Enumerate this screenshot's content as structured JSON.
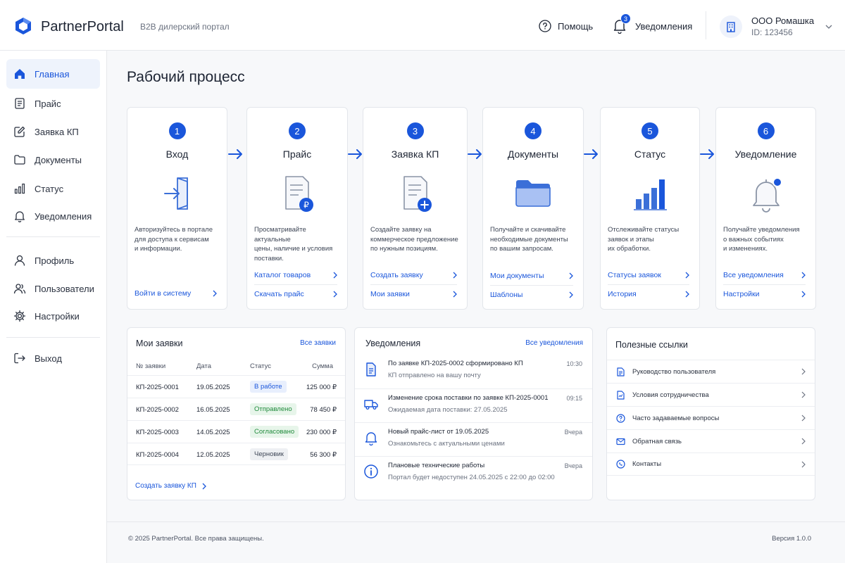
{
  "header": {
    "brand": "PartnerPortal",
    "tagline": "B2B дилерский портал",
    "help_label": "Помощь",
    "notifications_label": "Уведомления",
    "notifications_count": "3",
    "company_name": "ООО Ромашка",
    "company_id": "ID: 123456"
  },
  "sidebar": {
    "items": [
      {
        "label": "Главная",
        "icon": "home-icon",
        "active": true
      },
      {
        "label": "Прайс",
        "icon": "document-icon"
      },
      {
        "label": "Заявка КП",
        "icon": "edit-icon"
      },
      {
        "label": "Документы",
        "icon": "folder-icon"
      },
      {
        "label": "Статус",
        "icon": "chart-icon"
      },
      {
        "label": "Уведомления",
        "icon": "bell-icon"
      },
      {
        "label": "Профиль",
        "icon": "user-icon"
      },
      {
        "label": "Пользователи",
        "icon": "users-icon"
      },
      {
        "label": "Настройки",
        "icon": "gear-icon"
      },
      {
        "label": "Выход",
        "icon": "logout-icon"
      }
    ]
  },
  "main": {
    "title": "Рабочий процесс",
    "steps": [
      {
        "num": "1",
        "title": "Вход",
        "desc": [
          "Авторизуйтесь в портале",
          "для доступа к сервисам",
          "и информации."
        ],
        "links": [
          "Войти в систему"
        ]
      },
      {
        "num": "2",
        "title": "Прайс",
        "desc": [
          "Просматривайте актуальные",
          "цены, наличие и условия",
          "поставки."
        ],
        "links": [
          "Каталог товаров",
          "Скачать прайс"
        ]
      },
      {
        "num": "3",
        "title": "Заявка КП",
        "desc": [
          "Создайте заявку на",
          "коммерческое предложение",
          "по нужным позициям."
        ],
        "links": [
          "Создать заявку",
          "Мои заявки"
        ]
      },
      {
        "num": "4",
        "title": "Документы",
        "desc": [
          "Получайте и скачивайте",
          "необходимые документы",
          "по вашим запросам."
        ],
        "links": [
          "Мои документы",
          "Шаблоны"
        ]
      },
      {
        "num": "5",
        "title": "Статус",
        "desc": [
          "Отслеживайте статусы",
          "заявок и этапы",
          "их обработки."
        ],
        "links": [
          "Статусы заявок",
          "История"
        ]
      },
      {
        "num": "6",
        "title": "Уведомление",
        "desc": [
          "Получайте уведомления",
          "о важных событиях",
          "и изменениях."
        ],
        "links": [
          "Все уведомления",
          "Настройки"
        ]
      }
    ]
  },
  "orders": {
    "title": "Мои заявки",
    "all_link": "Все заявки",
    "columns": [
      "№ заявки",
      "Дата",
      "Статус",
      "Сумма"
    ],
    "rows": [
      {
        "id": "КП-2025-0001",
        "date": "19.05.2025",
        "status": "В работе",
        "sum": "125 000 ₽"
      },
      {
        "id": "КП-2025-0002",
        "date": "16.05.2025",
        "status": "Отправлено",
        "sum": "78 450 ₽"
      },
      {
        "id": "КП-2025-0003",
        "date": "14.05.2025",
        "status": "Согласовано",
        "sum": "230 000 ₽"
      },
      {
        "id": "КП-2025-0004",
        "date": "12.05.2025",
        "status": "Черновик",
        "sum": "56 300 ₽"
      }
    ],
    "create_link": "Создать заявку КП"
  },
  "notifications": {
    "title": "Уведомления",
    "all_link": "Все уведомления",
    "items": [
      {
        "icon": "document-icon",
        "title": "По заявке КП-2025-0002 сформировано КП",
        "sub": "КП отправлено на вашу почту",
        "time": "10:30"
      },
      {
        "icon": "truck-icon",
        "title": "Изменение срока поставки по заявке КП-2025-0001",
        "sub": "Ожидаемая дата поставки: 27.05.2025",
        "time": "09:15"
      },
      {
        "icon": "bell-icon",
        "title": "Новый прайс-лист от 19.05.2025",
        "sub": "Ознакомьтесь с актуальными ценами",
        "time": "Вчера"
      },
      {
        "icon": "info-icon",
        "title": "Плановые технические работы",
        "sub": "Портал будет недоступен 24.05.2025 с 22:00 до 02:00",
        "time": "Вчера"
      }
    ]
  },
  "links": {
    "title": "Полезные ссылки",
    "items": [
      {
        "icon": "manual-icon",
        "label": "Руководство пользователя"
      },
      {
        "icon": "contract-icon",
        "label": "Условия сотрудничества"
      },
      {
        "icon": "question-icon",
        "label": "Часто задаваемые вопросы"
      },
      {
        "icon": "mail-icon",
        "label": "Обратная связь"
      },
      {
        "icon": "phone-icon",
        "label": "Контакты"
      }
    ]
  },
  "footer": {
    "copyright": "© 2025 PartnerPortal. Все права защищены.",
    "version": "Версия 1.0.0"
  },
  "colors": {
    "accent": "#1a56db",
    "status_in_work": "#e8effd",
    "status_sent": "#e7f5ea",
    "status_agreed": "#e7f5ea",
    "status_draft": "#eef0f3"
  }
}
